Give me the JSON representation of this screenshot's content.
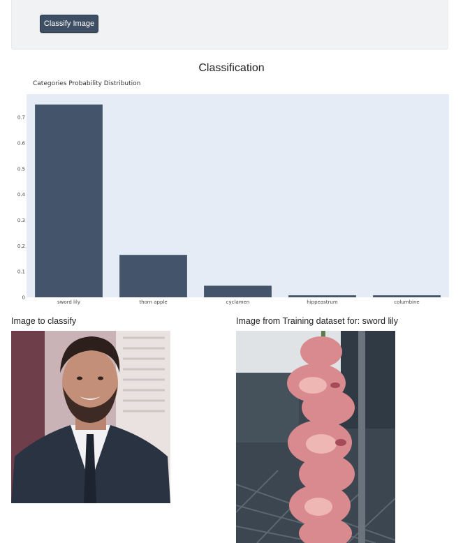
{
  "toolbar": {
    "classify_label": "Classify Image"
  },
  "section": {
    "title": "Classification"
  },
  "chart_data": {
    "type": "bar",
    "title": "Categories Probability Distribution",
    "categories": [
      "sword lily",
      "thorn apple",
      "cyclamen",
      "hippeastrum",
      "columbine"
    ],
    "values": [
      0.75,
      0.165,
      0.045,
      0.008,
      0.008
    ],
    "yticks": [
      "0",
      "0.1",
      "0.2",
      "0.3",
      "0.4",
      "0.5",
      "0.6",
      "0.7"
    ],
    "ylim": [
      0,
      0.79
    ],
    "grid": false,
    "bar_color": "#44546a",
    "plot_bg": "#e5ecf5"
  },
  "images": {
    "query_label": "Image to classify",
    "training_label": "Image from Training dataset for: sword lily"
  }
}
